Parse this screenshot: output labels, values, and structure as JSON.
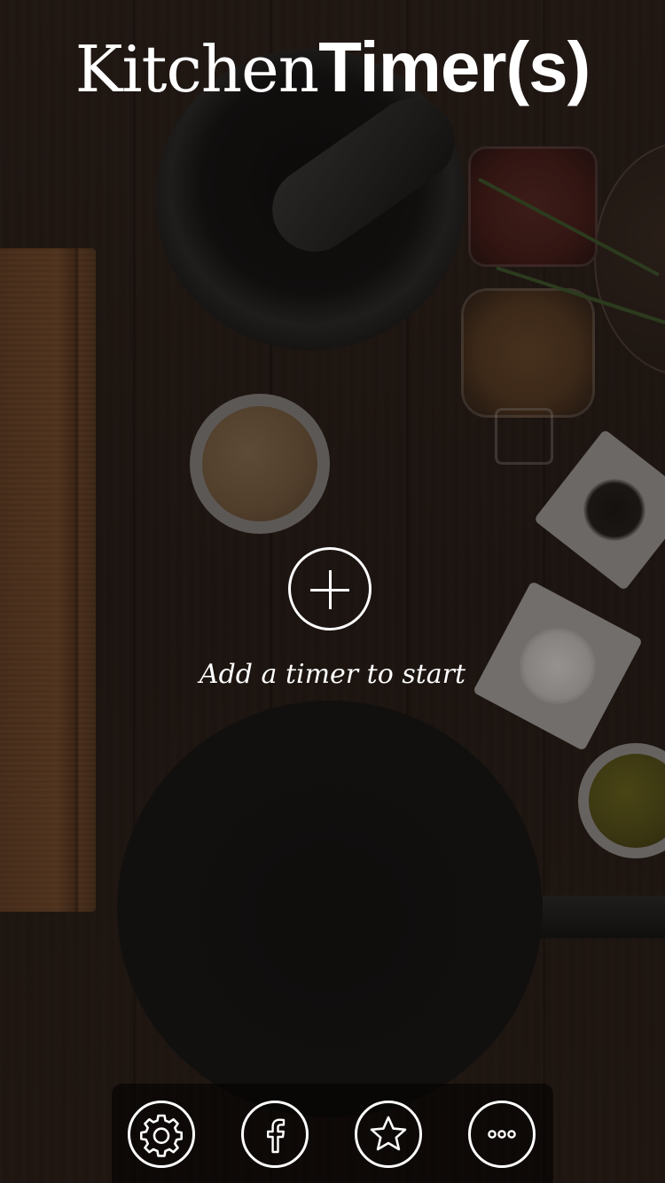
{
  "app": {
    "title_light": "Kitchen",
    "title_bold": "Timer(s)"
  },
  "main": {
    "add_button_icon": "plus-circle-icon",
    "hint": "Add a timer to start"
  },
  "toolbar": {
    "buttons": [
      {
        "icon": "gear-icon"
      },
      {
        "icon": "facebook-icon"
      },
      {
        "icon": "star-icon"
      },
      {
        "icon": "ellipsis-icon"
      }
    ]
  },
  "colors": {
    "foreground": "#ffffff",
    "toolbar_background": "rgba(0,0,0,0.55)"
  }
}
